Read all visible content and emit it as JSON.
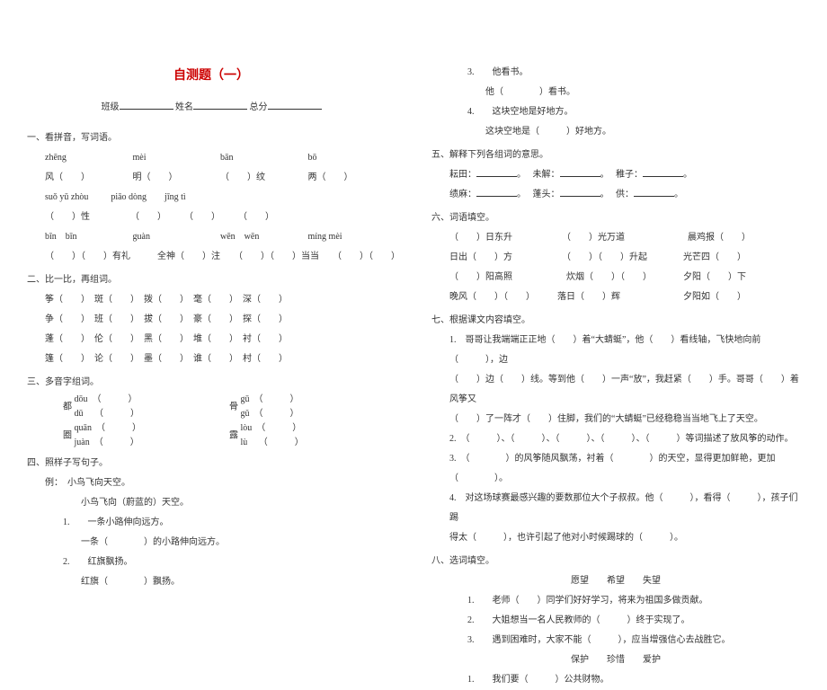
{
  "title": "自测题（一）",
  "header": {
    "class_label": "班级",
    "name_label": "姓名",
    "score_label": "总分"
  },
  "sections": {
    "s1": {
      "heading": "一、看拼音，写词语。",
      "row1": {
        "p1": "zhēng",
        "p2": "mèi",
        "p3": "bān",
        "p4": "bō"
      },
      "row2": {
        "c1": "风（　　）",
        "c2": "明（　　）",
        "c3": "（　　）纹",
        "c4": "两（　　）"
      },
      "row3a": "suǒ yǔ zhòu",
      "row3b": "piāo dòng　　jīng tì",
      "row4": "（　　）性　　　　　（　　）　　　（　　）　　　（　　）",
      "row5": {
        "p1": "bīn　bīn",
        "p2": "guàn",
        "p3": "wēn　wēn",
        "p4": "míng mèi"
      },
      "row6": "（　　）（　　）有礼　　　全神（　　）注　　（　　）（　　）当当　　（　　）（　　）"
    },
    "s2": {
      "heading": "二、比一比，再组词。",
      "r1": "筝（　　）　斑（　　）　拨（　　）　毫（　　）　深（　　）",
      "r2": "争（　　）　班（　　）　拔（　　）　豪（　　）　探（　　）",
      "r3": "蓬（　　）　伦（　　）　黑（　　）　堆（　　）　衬（　　）",
      "r4": "篷（　　）　论（　　）　墨（　　）　谁（　　）　村（　　）"
    },
    "s3": {
      "heading": "三、多音字组词。",
      "char1": "都",
      "char1_p1": "dōu　（　　　）",
      "char1_p2": "dū　 （　　　）",
      "char2": "骨",
      "char2_p1": "gū　（　　　）",
      "char2_p2": "gǔ　（　　　）",
      "char3": "圈",
      "char3_p1": "quān　（　　　）",
      "char3_p2": "juàn　（　　　）",
      "char4": "露",
      "char4_p1": "lòu　（　　　）",
      "char4_p2": "lù　 （　　　）"
    },
    "s4": {
      "heading": "四、照样子写句子。",
      "example": "例：　小鸟飞向天空。",
      "example2": "小鸟飞向（蔚蓝的）天空。",
      "q1": "1.　　一条小路伸向远方。",
      "q1b": "一条（　　　　）的小路伸向远方。",
      "q2": "2.　　红旗飘扬。",
      "q2b": "红旗（　　　　）飘扬。",
      "q3": "3.　　他看书。",
      "q3b": "他（　　　　）看书。",
      "q4": "4.　　这块空地是好地方。",
      "q4b": "这块空地是（　　　）好地方。"
    },
    "s5": {
      "heading": "五、解释下列各组词的意思。",
      "r1": {
        "a": "耘田：",
        "b": "未解：",
        "c": "稚子："
      },
      "r2": {
        "a": "绩麻：",
        "b": "蓬头：",
        "c": "供："
      }
    },
    "s6": {
      "heading": "六、词语填空。",
      "r1": "（　　）日东升　　　　　　（　　）光万道　　　　　　　晨鸡报（　　）",
      "r2": "日出（　　）方　　　　　　（　　）（　　）升起　　　　光芒四（　　）",
      "r3": "（　　）阳高照　　　　　　炊烟（　　）（　　）　　　　夕阳（　　）下",
      "r4": "晚风（　　）（　　）　　　落日（　　）辉　　　　　　　夕阳如（　　）"
    },
    "s7": {
      "heading": "七、根据课文内容填空。",
      "p1": "1.　哥哥让我端端正正地（　　）着“大蜻蜓”，他（　　）看线轴，飞快地向前（　　　），边",
      "p1b": "（　　）边（　　）线。等到他（　　）一声“放”，我赶紧（　　）手。哥哥（　　）着风筝又",
      "p1c": "（　　）了一阵才（　　）住脚，我们的“大蜻蜓”已经稳稳当当地飞上了天空。",
      "p2": "2.　（　　　）、（　　　）、（　　　）、（　　　）、（　　　）等词描述了放风筝的动作。",
      "p3": "3.　（　　　　）的风筝随风飘荡，衬着（　　　　）的天空，显得更加鲜艳，更加（　　　　）。",
      "p4": "4.　对这场球赛最感兴趣的要数那位大个子叔叔。他（　　　），看得（　　　），孩子们踢",
      "p4b": "得太（　　　），也许引起了他对小时候踢球的（　　　）。"
    },
    "s8": {
      "heading": "八、选词填空。",
      "group1": "愿望　　希望　　失望",
      "q1": "1.　　老师（　　）同学们好好学习，将来为祖国多做贡献。",
      "q2": "2.　　大姐想当一名人民教师的（　　　）终于实现了。",
      "q3": "3.　　遇到困难时，大家不能（　　　），应当增强信心去战胜它。",
      "group2": "保护　　珍惜　　爱护",
      "q4": "1.　　我们要（　　　）公共财物。"
    }
  }
}
